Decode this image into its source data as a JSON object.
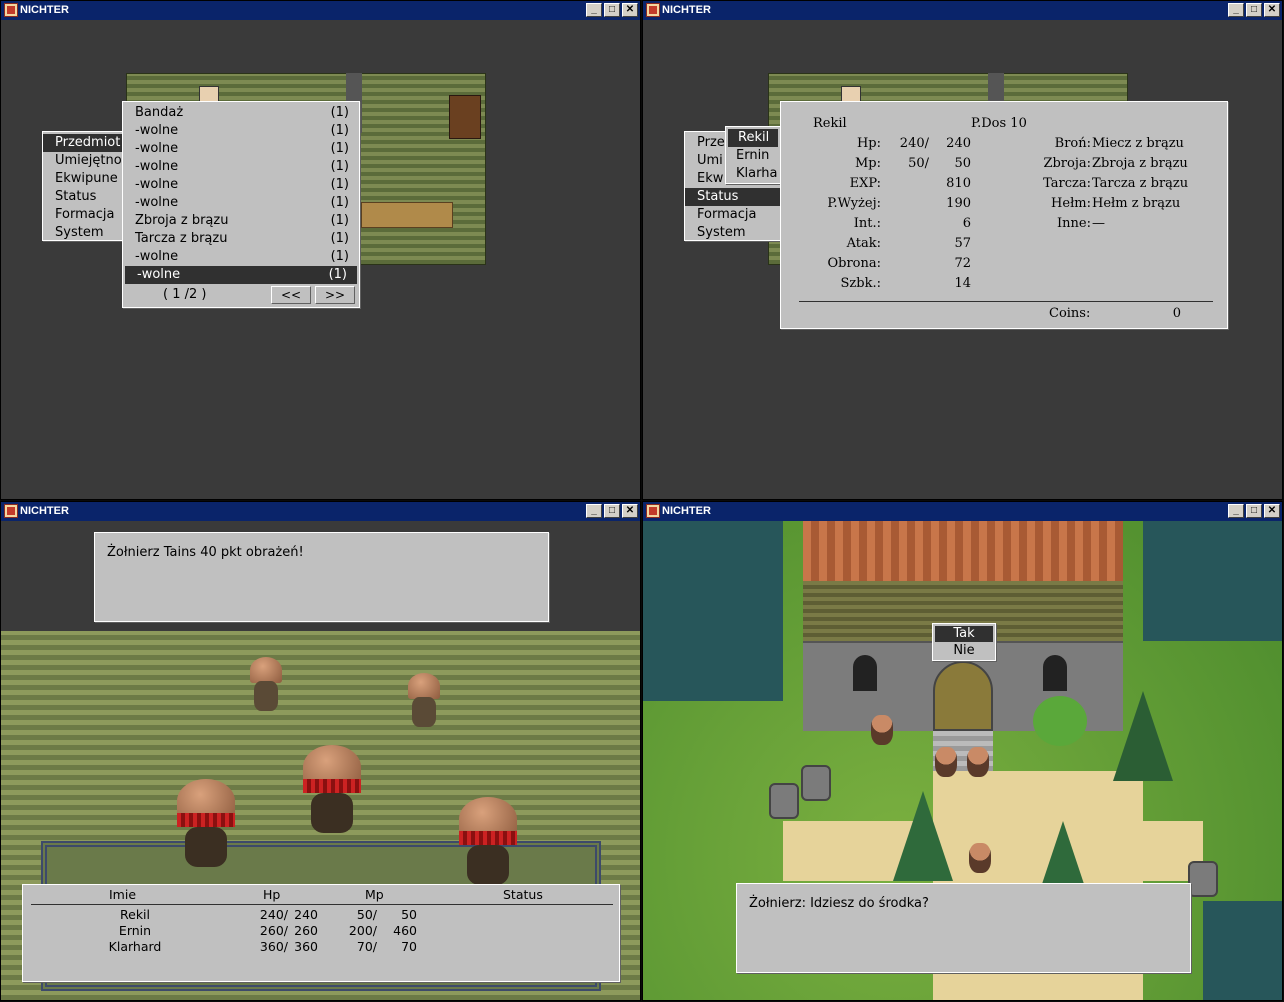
{
  "windows": {
    "w1": {
      "title": "NICHTER"
    },
    "w2": {
      "title": "NICHTER"
    },
    "w3": {
      "title": "NICHTER"
    },
    "w4": {
      "title": "NICHTER"
    }
  },
  "titlebar_buttons": {
    "minimize": "_",
    "maximize": "□",
    "close": "✕"
  },
  "main_menu": {
    "items": [
      "Przedmioty",
      "Umiejętności",
      "Ekwipunek",
      "Status",
      "Formacja",
      "System"
    ],
    "visible_w1": [
      "Przedmiot",
      "Umiejętno",
      "Ekwipune",
      "Status",
      "Formacja",
      "System"
    ],
    "visible_w2": [
      "Prze",
      "Umi",
      "Ekw",
      "Status",
      "Formacja",
      "System"
    ]
  },
  "inventory": {
    "items": [
      {
        "name": "Bandaż",
        "count": "(1)"
      },
      {
        "name": "-wolne",
        "count": "(1)"
      },
      {
        "name": "-wolne",
        "count": "(1)"
      },
      {
        "name": "-wolne",
        "count": "(1)"
      },
      {
        "name": "-wolne",
        "count": "(1)"
      },
      {
        "name": "-wolne",
        "count": "(1)"
      },
      {
        "name": "Zbroja z brązu",
        "count": "(1)"
      },
      {
        "name": "Tarcza z brązu",
        "count": "(1)"
      },
      {
        "name": "-wolne",
        "count": "(1)"
      },
      {
        "name": "-wolne",
        "count": "(1)"
      }
    ],
    "page": "( 1  /2 )",
    "prev": "<<",
    "next": ">>"
  },
  "party_submenu": {
    "items": [
      "Rekil",
      "Ernin",
      "Klarha"
    ]
  },
  "status": {
    "name": "Rekil",
    "pdos": "P.Dos 10",
    "labels": [
      "Hp:",
      "Mp:",
      "EXP:",
      "P.Wyżej:",
      "Int.:",
      "Atak:",
      "Obrona:",
      "Szbk.:"
    ],
    "values_a": [
      "240/",
      "50/",
      "",
      "",
      "",
      "",
      "",
      ""
    ],
    "values_b": [
      "240",
      "50",
      "810",
      "190",
      "6",
      "57",
      "72",
      "14"
    ],
    "equip_labels": [
      "Broń:",
      "Zbroja:",
      "Tarcza:",
      "Hełm:",
      "Inne:"
    ],
    "equip_values": [
      "Miecz z brązu",
      "Zbroja z brązu",
      "Tarcza z brązu",
      "Hełm z brązu",
      "—"
    ],
    "coins_label": "Coins:",
    "coins_value": "0"
  },
  "battle": {
    "message": "Żołnierz Tains 40  pkt obrażeń!",
    "headers": [
      "Imie",
      "Hp",
      "Mp",
      "Status"
    ],
    "party": [
      {
        "name": "Rekil",
        "hp_cur": "240/",
        "hp_max": "240",
        "mp_cur": "50/",
        "mp_max": "50"
      },
      {
        "name": "Ernin",
        "hp_cur": "260/",
        "hp_max": "260",
        "mp_cur": "200/",
        "mp_max": "460"
      },
      {
        "name": "Klarhard",
        "hp_cur": "360/",
        "hp_max": "360",
        "mp_cur": "70/",
        "mp_max": "70"
      }
    ]
  },
  "village": {
    "choice_yes": "Tak",
    "choice_no": "Nie",
    "dialog": "Żołnierz: Idziesz do środka?"
  },
  "colors": {
    "titlebar": "#0a246a",
    "panel": "#c0c0c0",
    "selected": "#303030"
  }
}
